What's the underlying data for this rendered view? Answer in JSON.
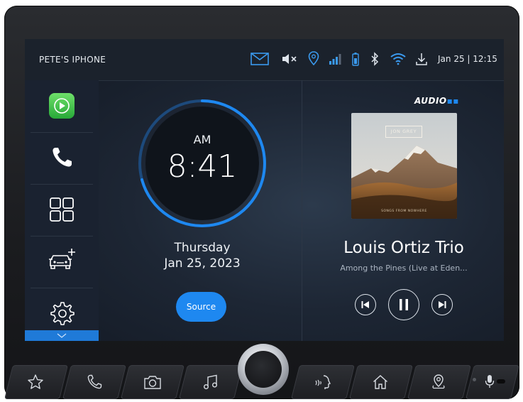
{
  "status_bar": {
    "phone_name": "PETE'S IPHONE",
    "datetime": "Jan 25 | 12:15",
    "icons": [
      "mail-icon",
      "mute-icon",
      "location-pin-icon",
      "signal-icon",
      "battery-icon",
      "bluetooth-icon",
      "wifi-icon",
      "download-icon"
    ]
  },
  "sidebar": {
    "items": [
      {
        "name": "carplay",
        "icon": "carplay-icon"
      },
      {
        "name": "phone",
        "icon": "phone-icon"
      },
      {
        "name": "apps",
        "icon": "apps-grid-icon"
      },
      {
        "name": "vehicle",
        "icon": "car-add-icon"
      },
      {
        "name": "settings",
        "icon": "gear-icon"
      }
    ],
    "more_icon": "chevron-down-icon"
  },
  "clock": {
    "ampm": "AM",
    "time": "8:41",
    "day": "Thursday",
    "date": "Jan 25, 2023"
  },
  "source_button": {
    "label": "Source"
  },
  "media": {
    "provider_logo": "AUDIO",
    "album_artist_label": "JON GREY",
    "album_subtitle": "SONGS FROM NOWHERE",
    "artist": "Louis Ortiz Trio",
    "track": "Among the Pines (Live at Eden..."
  },
  "hardware_buttons": [
    "star-icon",
    "phone-icon",
    "camera-icon",
    "music-icon",
    "voice-icon",
    "home-icon",
    "navigation-icon",
    "microphone-icon"
  ],
  "colors": {
    "accent": "#1e88f0",
    "carplay_green": "#3ec64a"
  }
}
